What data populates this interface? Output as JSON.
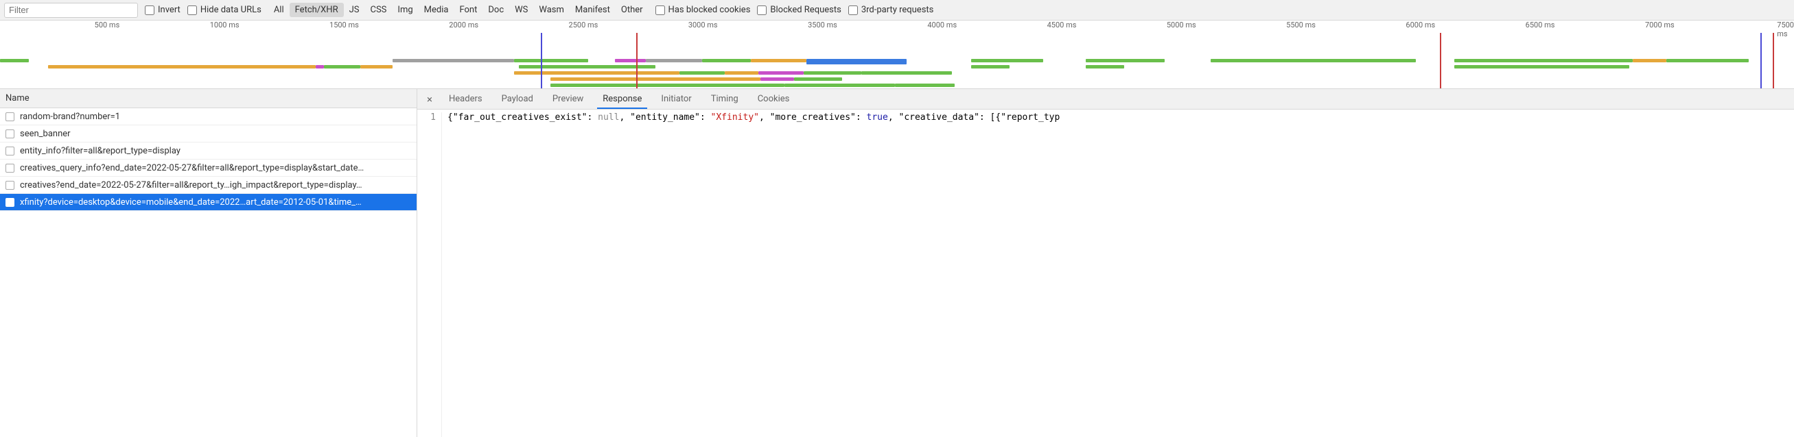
{
  "filter": {
    "placeholder": "Filter",
    "invert": "Invert",
    "hide_data_urls": "Hide data URLs",
    "types": [
      "All",
      "Fetch/XHR",
      "JS",
      "CSS",
      "Img",
      "Media",
      "Font",
      "Doc",
      "WS",
      "Wasm",
      "Manifest",
      "Other"
    ],
    "active_type": "Fetch/XHR",
    "has_blocked_cookies": "Has blocked cookies",
    "blocked_requests": "Blocked Requests",
    "third_party": "3rd-party requests"
  },
  "timeline": {
    "range_ms": 7500,
    "ticks_ms": [
      500,
      1000,
      1500,
      2000,
      2500,
      3000,
      3500,
      4000,
      4500,
      5000,
      5500,
      6000,
      6500,
      7000,
      7500
    ],
    "bars": [
      {
        "start": 0,
        "end": 120,
        "row": 0,
        "color": "#6abf4b"
      },
      {
        "start": 200,
        "end": 1320,
        "row": 1,
        "color": "#e5a73a"
      },
      {
        "start": 1320,
        "end": 1355,
        "row": 1,
        "color": "#c850c8"
      },
      {
        "start": 1355,
        "end": 1505,
        "row": 1,
        "color": "#6abf4b"
      },
      {
        "start": 1505,
        "end": 1640,
        "row": 1,
        "color": "#e5a73a"
      },
      {
        "start": 1640,
        "end": 2150,
        "row": 0,
        "color": "#a0a0a0"
      },
      {
        "start": 2150,
        "end": 2460,
        "row": 0,
        "color": "#6abf4b"
      },
      {
        "start": 2150,
        "end": 2840,
        "row": 2,
        "color": "#e5a73a"
      },
      {
        "start": 2170,
        "end": 2740,
        "row": 1,
        "color": "#6abf4b"
      },
      {
        "start": 2300,
        "end": 3180,
        "row": 3,
        "color": "#e5a73a"
      },
      {
        "start": 2300,
        "end": 3280,
        "row": 4,
        "color": "#6abf4b"
      },
      {
        "start": 2570,
        "end": 2700,
        "row": 0,
        "color": "#c850c8"
      },
      {
        "start": 2700,
        "end": 2935,
        "row": 0,
        "color": "#a0a0a0"
      },
      {
        "start": 2935,
        "end": 3140,
        "row": 0,
        "color": "#6abf4b"
      },
      {
        "start": 2840,
        "end": 3030,
        "row": 2,
        "color": "#6abf4b"
      },
      {
        "start": 3030,
        "end": 3170,
        "row": 2,
        "color": "#e5a73a"
      },
      {
        "start": 3170,
        "end": 3360,
        "row": 2,
        "color": "#c850c8"
      },
      {
        "start": 3180,
        "end": 3320,
        "row": 3,
        "color": "#c850c8"
      },
      {
        "start": 3280,
        "end": 3740,
        "row": 4,
        "color": "#6abf4b"
      },
      {
        "start": 3140,
        "end": 3370,
        "row": 0,
        "color": "#e5a73a"
      },
      {
        "start": 3370,
        "end": 3790,
        "row": 0,
        "color": "#3a7be0",
        "thick": true
      },
      {
        "start": 3360,
        "end": 3600,
        "row": 2,
        "color": "#6abf4b"
      },
      {
        "start": 3320,
        "end": 3520,
        "row": 3,
        "color": "#6abf4b"
      },
      {
        "start": 3600,
        "end": 3980,
        "row": 2,
        "color": "#6abf4b"
      },
      {
        "start": 3740,
        "end": 3990,
        "row": 4,
        "color": "#6abf4b"
      },
      {
        "start": 4060,
        "end": 4360,
        "row": 0,
        "color": "#6abf4b"
      },
      {
        "start": 4060,
        "end": 4220,
        "row": 1,
        "color": "#6abf4b"
      },
      {
        "start": 4540,
        "end": 4870,
        "row": 0,
        "color": "#6abf4b"
      },
      {
        "start": 4540,
        "end": 4700,
        "row": 1,
        "color": "#6abf4b"
      },
      {
        "start": 5060,
        "end": 5920,
        "row": 0,
        "color": "#6abf4b"
      },
      {
        "start": 6080,
        "end": 6825,
        "row": 0,
        "color": "#6abf4b"
      },
      {
        "start": 6080,
        "end": 6810,
        "row": 1,
        "color": "#6abf4b"
      },
      {
        "start": 6825,
        "end": 6965,
        "row": 0,
        "color": "#e5a73a"
      },
      {
        "start": 6965,
        "end": 7310,
        "row": 0,
        "color": "#6abf4b"
      }
    ],
    "vlines": [
      {
        "at": 2260,
        "color": "#4a4ad6"
      },
      {
        "at": 2660,
        "color": "#c83a3a"
      },
      {
        "at": 6020,
        "color": "#c83a3a"
      },
      {
        "at": 7360,
        "color": "#4a4ad6"
      },
      {
        "at": 7410,
        "color": "#c83a3a"
      }
    ]
  },
  "requests": {
    "header": "Name",
    "items": [
      {
        "name": "random-brand?number=1"
      },
      {
        "name": "seen_banner"
      },
      {
        "name": "entity_info?filter=all&report_type=display"
      },
      {
        "name": "creatives_query_info?end_date=2022-05-27&filter=all&report_type=display&start_date…"
      },
      {
        "name": "creatives?end_date=2022-05-27&filter=all&report_ty…igh_impact&report_type=display…"
      },
      {
        "name": "xfinity?device=desktop&device=mobile&end_date=2022…art_date=2012-05-01&time_…"
      }
    ],
    "selected_index": 5
  },
  "detail": {
    "tabs": [
      "Headers",
      "Payload",
      "Preview",
      "Response",
      "Initiator",
      "Timing",
      "Cookies"
    ],
    "active_tab": "Response",
    "line_no": "1",
    "response_tokens": [
      {
        "t": "{",
        "c": ""
      },
      {
        "t": "\"far_out_creatives_exist\"",
        "c": ""
      },
      {
        "t": ": ",
        "c": ""
      },
      {
        "t": "null",
        "c": "null"
      },
      {
        "t": ", ",
        "c": ""
      },
      {
        "t": "\"entity_name\"",
        "c": ""
      },
      {
        "t": ": ",
        "c": ""
      },
      {
        "t": "\"Xfinity\"",
        "c": "str"
      },
      {
        "t": ", ",
        "c": ""
      },
      {
        "t": "\"more_creatives\"",
        "c": ""
      },
      {
        "t": ": ",
        "c": ""
      },
      {
        "t": "true",
        "c": "bool"
      },
      {
        "t": ", ",
        "c": ""
      },
      {
        "t": "\"creative_data\"",
        "c": ""
      },
      {
        "t": ": [{",
        "c": ""
      },
      {
        "t": "\"report_typ",
        "c": ""
      }
    ]
  }
}
